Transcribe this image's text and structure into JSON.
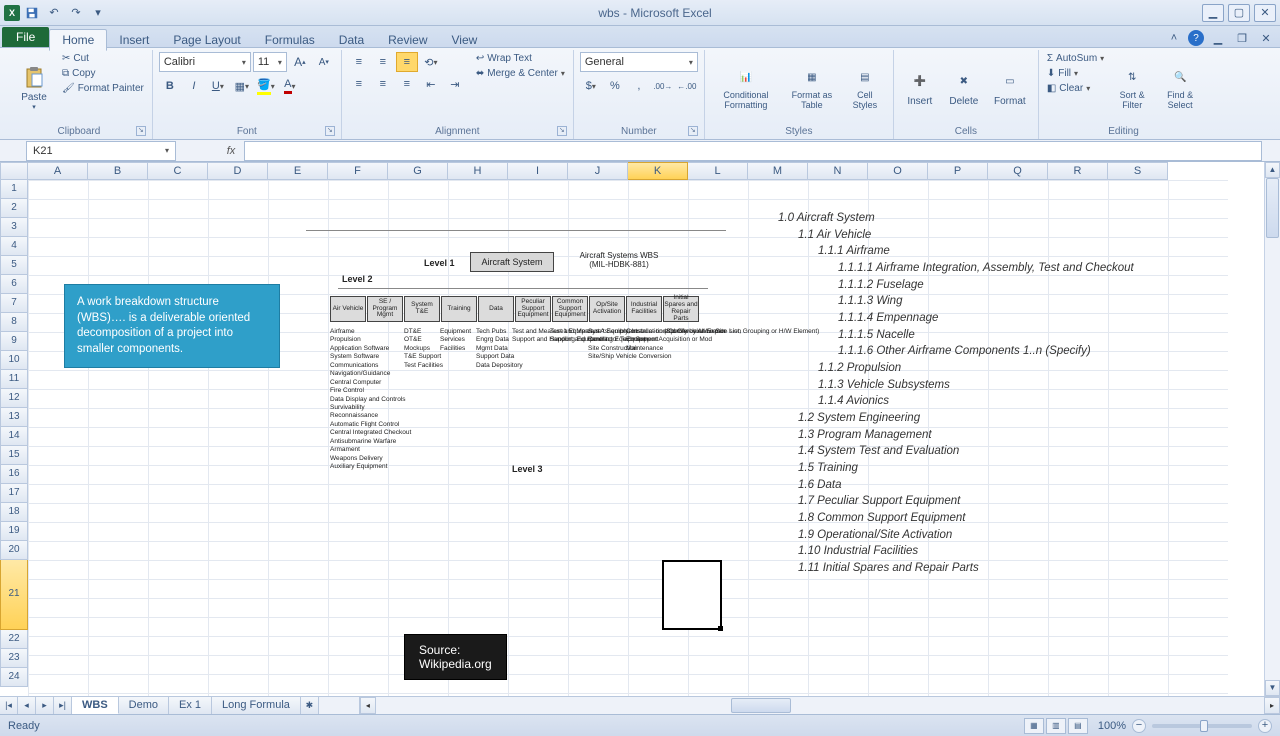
{
  "app": {
    "title": "wbs - Microsoft Excel"
  },
  "tabs": {
    "file": "File",
    "items": [
      "Home",
      "Insert",
      "Page Layout",
      "Formulas",
      "Data",
      "Review",
      "View"
    ],
    "active": 0
  },
  "ribbon": {
    "clipboard": {
      "label": "Clipboard",
      "paste": "Paste",
      "cut": "Cut",
      "copy": "Copy",
      "painter": "Format Painter"
    },
    "font": {
      "label": "Font",
      "name": "Calibri",
      "size": "11"
    },
    "alignment": {
      "label": "Alignment",
      "wrap": "Wrap Text",
      "merge": "Merge & Center"
    },
    "number": {
      "label": "Number",
      "format": "General"
    },
    "styles": {
      "label": "Styles",
      "cond": "Conditional Formatting",
      "fat": "Format as Table",
      "cell": "Cell Styles"
    },
    "cells": {
      "label": "Cells",
      "insert": "Insert",
      "delete": "Delete",
      "format": "Format"
    },
    "editing": {
      "label": "Editing",
      "autosum": "AutoSum",
      "fill": "Fill",
      "clear": "Clear",
      "sort": "Sort & Filter",
      "find": "Find & Select"
    }
  },
  "namebox": "K21",
  "columns": [
    "A",
    "B",
    "C",
    "D",
    "E",
    "F",
    "G",
    "H",
    "I",
    "J",
    "K",
    "L",
    "M",
    "N",
    "O",
    "P",
    "Q",
    "R",
    "S"
  ],
  "active_col_index": 10,
  "rows_before_tall": 20,
  "tall_row": 21,
  "rows_after": [
    22,
    23,
    24
  ],
  "callout_text": "A work breakdown structure (WBS)…. is a deliverable oriented decomposition of a project into smaller components.",
  "source_label": "Source: Wikipedia.org",
  "wbs_outline": [
    {
      "lvl": 0,
      "t": "1.0 Aircraft System"
    },
    {
      "lvl": 1,
      "t": "1.1 Air Vehicle"
    },
    {
      "lvl": 2,
      "t": "1.1.1 Airframe"
    },
    {
      "lvl": 3,
      "t": "1.1.1.1 Airframe Integration, Assembly, Test and Checkout"
    },
    {
      "lvl": 3,
      "t": "1.1.1.2 Fuselage"
    },
    {
      "lvl": 3,
      "t": "1.1.1.3 Wing"
    },
    {
      "lvl": 3,
      "t": "1.1.1.4 Empennage"
    },
    {
      "lvl": 3,
      "t": "1.1.1.5 Nacelle"
    },
    {
      "lvl": 3,
      "t": "1.1.1.6 Other Airframe Components 1..n (Specify)"
    },
    {
      "lvl": 2,
      "t": "1.1.2 Propulsion"
    },
    {
      "lvl": 2,
      "t": "1.1.3 Vehicle Subsystems"
    },
    {
      "lvl": 2,
      "t": "1.1.4 Avionics"
    },
    {
      "lvl": 1,
      "t": "1.2 System Engineering"
    },
    {
      "lvl": 1,
      "t": "1.3 Program Management"
    },
    {
      "lvl": 1,
      "t": "1.4 System Test and Evaluation"
    },
    {
      "lvl": 1,
      "t": "1.5 Training"
    },
    {
      "lvl": 1,
      "t": "1.6 Data"
    },
    {
      "lvl": 1,
      "t": "1.7 Peculiar Support Equipment"
    },
    {
      "lvl": 1,
      "t": "1.8 Common Support Equipment"
    },
    {
      "lvl": 1,
      "t": "1.9 Operational/Site Activation"
    },
    {
      "lvl": 1,
      "t": "1.10 Industrial Facilities"
    },
    {
      "lvl": 1,
      "t": "1.11 Initial Spares and Repair Parts"
    }
  ],
  "diagram": {
    "level1": "Level 1",
    "level2": "Level 2",
    "level3": "Level 3",
    "top_box": "Aircraft System",
    "head_right": "Aircraft Systems WBS\n(MIL-HDBK-881)",
    "l2": [
      "Air Vehicle",
      "SE / Program Mgmt",
      "System T&E",
      "Training",
      "Data",
      "Peculiar Support Equipment",
      "Common Support Equipment",
      "Op/Site Activation",
      "Industrial Facilities",
      "Initial Spares and Repair Parts"
    ],
    "l3cols": [
      [
        "Airframe",
        "Propulsion",
        "Application Software",
        "System Software",
        "Communications",
        "Navigation/Guidance",
        "Central Computer",
        "Fire Control",
        "Data Display and Controls",
        "Survivability",
        "Reconnaissance",
        "Automatic Flight Control",
        "Central Integrated Checkout",
        "Antisubmarine Warfare",
        "Armament",
        "Weapons Delivery",
        "Auxiliary Equipment"
      ],
      [
        "DT&E",
        "OT&E",
        "Mockups",
        "T&E Support",
        "Test Facilities"
      ],
      [
        "Equipment",
        "Services",
        "Facilities"
      ],
      [
        "Tech Pubs",
        "Engrg Data",
        "Mgmt Data",
        "Support Data",
        "Data Depository"
      ],
      [
        "Test and Measure't Equipment",
        "Support and Handling Equipment"
      ],
      [
        "Test and Measure't Equipment",
        "Support and Handling Equipment"
      ],
      [
        "Sys Assembly, Installation and Checkout on Site",
        "Contractor Tech Support",
        "Site Construction",
        "Site/Ship Vehicle Conversion"
      ],
      [
        "Construc- tion/Conver- sion/Expan- sion",
        "Equipment Acquisition or Mod",
        "Maintenance"
      ],
      [
        "(Specify by Allowance List, Grouping or H/W Element)"
      ]
    ]
  },
  "sheet_tabs": [
    "WBS",
    "Demo",
    "Ex 1",
    "Long Formula"
  ],
  "sheet_active": 0,
  "status": {
    "ready": "Ready",
    "zoom": "100%"
  }
}
